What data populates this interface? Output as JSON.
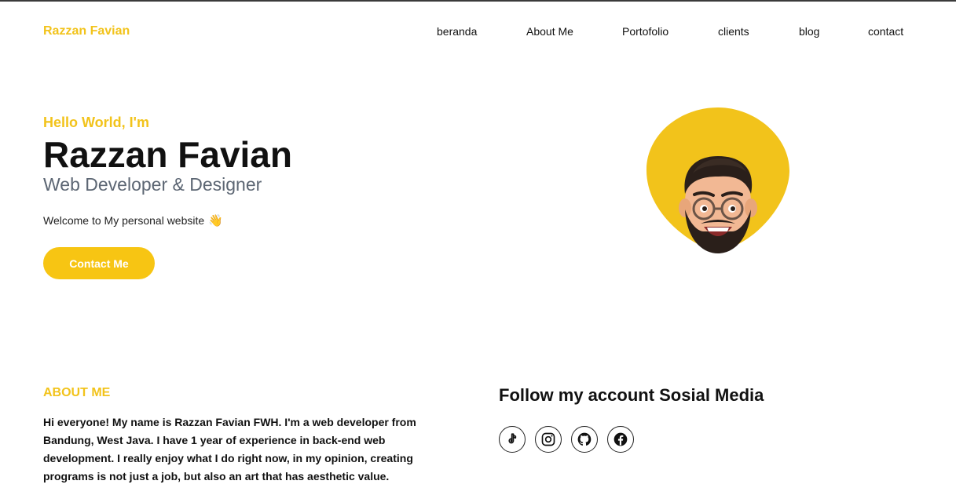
{
  "brand": "Razzan Favian",
  "nav": [
    "beranda",
    "About Me",
    "Portofolio",
    "clients",
    "blog",
    "contact"
  ],
  "hero": {
    "greeting": "Hello World, I'm",
    "name": "Razzan Favian",
    "role": "Web Developer & Designer",
    "welcome": "Welcome to My personal website",
    "welcome_emoji": "👋",
    "cta": "Contact Me"
  },
  "about": {
    "heading": "ABOUT ME",
    "text": "Hi everyone! My name is Razzan Favian FWH. I'm a web developer from Bandung, West Java. I have 1 year of experience in back-end web development. I really enjoy what I do right now, in my opinion, creating programs is not just a job, but also an art that has aesthetic value."
  },
  "social": {
    "heading": "Follow my account Sosial Media",
    "icons": [
      "tiktok-icon",
      "instagram-icon",
      "github-icon",
      "facebook-icon"
    ]
  },
  "colors": {
    "accent": "#f2c31b",
    "button": "#f7c513",
    "role_text": "#5c6673"
  }
}
